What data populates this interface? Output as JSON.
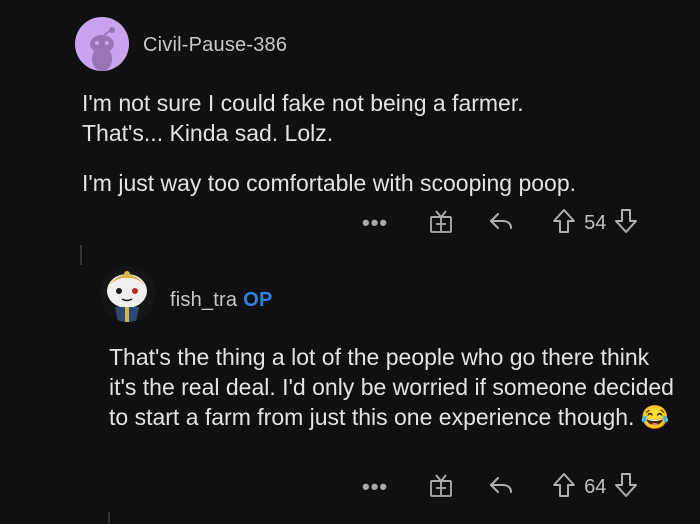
{
  "comments": [
    {
      "username": "Civil-Pause-386",
      "op_badge": "",
      "paragraphs": [
        "I'm not sure I could fake not being a farmer. That's... Kinda sad. Lolz.",
        "I'm just way too comfortable with scooping poop."
      ],
      "more_label": "•••",
      "score": "54",
      "avatar_color": "#b77de0"
    },
    {
      "username": "fish_tra",
      "op_badge": "OP",
      "paragraphs": [
        "That's the thing a lot of the people who go there think it's the real deal. I'd only be worried if someone decided to start a farm from just this one experience though. 😂"
      ],
      "more_label": "•••",
      "score": "64",
      "avatar_color": "#e8e8e8"
    }
  ],
  "icons": [
    "award-icon",
    "reply-icon",
    "upvote-icon",
    "downvote-icon",
    "more-icon"
  ],
  "colors": {
    "background": "#101010",
    "op_badge": "#2f7fe0",
    "text": "#e3e3e3"
  }
}
